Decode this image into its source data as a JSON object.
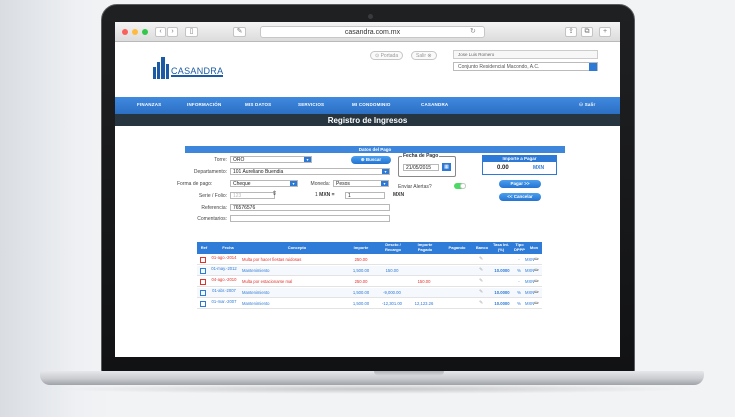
{
  "browser": {
    "url": "casandra.com.mx"
  },
  "header": {
    "logo": "CASANDRA",
    "pill_portada": "Portada",
    "pill_salir": "Salir",
    "user_name": "Jose Luis Romero",
    "condominio": "Conjunto Residencial Macondo, A.C."
  },
  "nav": {
    "items": [
      "FINANZAS",
      "INFORMACIÓN",
      "MIS DATOS",
      "SERVICIOS",
      "MI CONDOMINIO",
      "CASANDRA"
    ],
    "right": "Salir"
  },
  "page": {
    "title": "Registro de Ingresos"
  },
  "form": {
    "panel_title": "Datos del Pago",
    "torre_label": "Torre:",
    "torre_value": "ORO",
    "buscar_label": "Buscar",
    "depto_label": "Departamento:",
    "depto_value": "101 Aureliano Buendia",
    "forma_label": "Forma de pago:",
    "forma_value": "Cheque",
    "moneda_label": "Moneda:",
    "moneda_value": "Pesos",
    "serie_label": "Serie / Folio:",
    "serie_placeholder": "123",
    "tc_prefix": "1",
    "tc_mxn": "MXN =",
    "tc_value": "1",
    "tc_suffix": "MXN",
    "referencia_label": "Referencia:",
    "referencia_value": "76576576",
    "comentarios_label": "Comentarios:",
    "fecha_label": "Fecha de Pago",
    "fecha_value": "21/05/2015",
    "enviar_label": "Enviar Alertas?",
    "importe_title": "Importe a Pagar",
    "importe_value": "0.00",
    "importe_currency": "MXN",
    "pagar_label": "Pagar >>",
    "cancelar_label": "<< Cancelar"
  },
  "table": {
    "headers": [
      "Ref",
      "Fecha",
      "Concepto",
      "Importe",
      "Descto / Recargo",
      "Importe Pagado",
      "Pagando",
      "Banco",
      "Tasa Int. (%)",
      "Tipo DPPP",
      "Mon"
    ],
    "rows": [
      {
        "fecha": "01-ago.-2014",
        "concepto": "Multa por hacer fiestas ruidosas",
        "importe": "250.00",
        "descto": "",
        "pagado": "",
        "tasa": "",
        "tipo": "-",
        "mon": "MXN",
        "red": true
      },
      {
        "fecha": "01-may.-2012",
        "concepto": "Mantenimiento",
        "importe": "1,500.00",
        "descto": "150.00",
        "pagado": "",
        "tasa": "10.0000",
        "tipo": "%",
        "mon": "MXN",
        "red": false
      },
      {
        "fecha": "04-ago.-2010",
        "concepto": "Multa por estacionarse mal",
        "importe": "250.00",
        "descto": "",
        "pagado": "150.00",
        "tasa": "",
        "tipo": "-",
        "mon": "MXN",
        "red": true
      },
      {
        "fecha": "01-abr.-2007",
        "concepto": "Mantenimiento",
        "importe": "1,500.00",
        "descto": "-9,000.00",
        "pagado": "",
        "tasa": "10.0000",
        "tipo": "%",
        "mon": "MXN",
        "red": false
      },
      {
        "fecha": "01-mar.-2007",
        "concepto": "Mantenimiento",
        "importe": "1,500.00",
        "descto": "-12,301.00",
        "pagado": "12,123.26",
        "tasa": "10.0000",
        "tipo": "%",
        "mon": "MXN",
        "red": false
      }
    ]
  },
  "colors": {
    "accent": "#2d79d6",
    "danger": "#e0312b",
    "banner": "#26353f"
  }
}
